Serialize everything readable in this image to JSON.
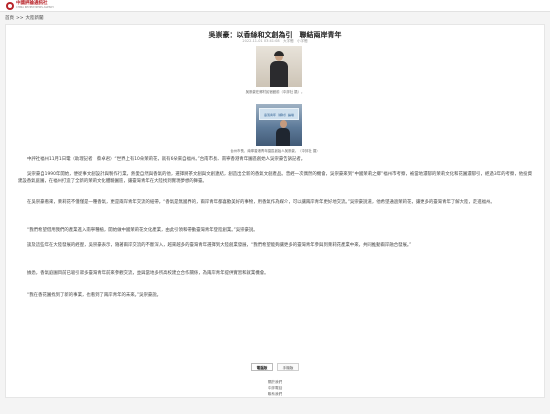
{
  "header": {
    "logo_text": "中國評論通訊社",
    "logo_sub": "CHINA REVIEW NEWS AGENCY"
  },
  "breadcrumb": {
    "home": "首頁",
    "sep": ">>",
    "section": "大陸新聞"
  },
  "article": {
    "title": "吳崇豪：以香絲和文創為引　聯結兩岸青年",
    "meta": "2022-11-01 03:41:08　大字體　小字體",
    "caption1": "吳崇豪在鄉村民宿館前（中評社 攝）。",
    "caption2": "台州市長、南寧香港青年園區創始人吳崇豪。（中評社 攝）",
    "banner_text": "臺灣青年（鄉村）論壇",
    "paragraphs": [
      "中評社福州11月1日電（助理記者　蔡卓君）“世界上有10朵茉莉花，就有6朵來自福州。”台南市長、南寧香港青年園區創始人吳崇豪告訴記者。",
      "吳崇豪自1990年開始，便從事文創設計與製作行業，熱愛自然與香氣的他，選擇將茶文創與文創連結，創造出全新的香氣文創產品。曾經一次偶然的機會，吳崇豪來到“中國茉莉之鄉”福州市考察，被當地濃郁的茉莉文化和花園濃郁引，經過3年的考察，他投資建設香氣庭園，在福州打造了全新的茉莉文化體驗園區，讓臺灣青年在大陸找到實現夢想的舞臺。",
      "在吳崇豪看來，茉莉花不僅僅是一種香氣，更是兩岸青年交流的紐帶。“香氣是無國界的，兩岸青年都喜歡美好的事物，用香氣作為媒介，可以讓兩岸青年更好地交流。”吳崇豪說道，他希望通過茉莉花，讓更多的臺灣青年了解大陸，走進福州。",
      "“我們希望借用我們的產業進入南寧種植，開始做中國茉莉花文化產業，由此引領和帶動臺灣青年登陸創業。”吳崇豪說。",
      "談及這些年在大陸發展的經歷，吳崇豪表示，隨著兩岸交流的不斷深入，越來越多的臺灣青年選擇到大陸創業發展，“我們希望能夠讓更多的臺灣青年參與到茉莉花產業中來，共同推動兩岸融合發展。”",
      "據悉，香氣庭園目前已吸引眾多臺灣青年前來參觀交流，並與當地多所高校建立合作關係，為兩岸青年提供實習和就業機會。",
      "“我在香花園找到了新的事業，也看到了兩岸青年的未來。”吳崇豪說。"
    ]
  },
  "buttons": {
    "print": "電腦版",
    "mobile": "手機版"
  },
  "footer": {
    "links": [
      "關於我們",
      "中評電話",
      "聯系我們"
    ]
  },
  "colors": {
    "brand_red": "#b8242a",
    "page_bg": "#f4f4f4"
  }
}
